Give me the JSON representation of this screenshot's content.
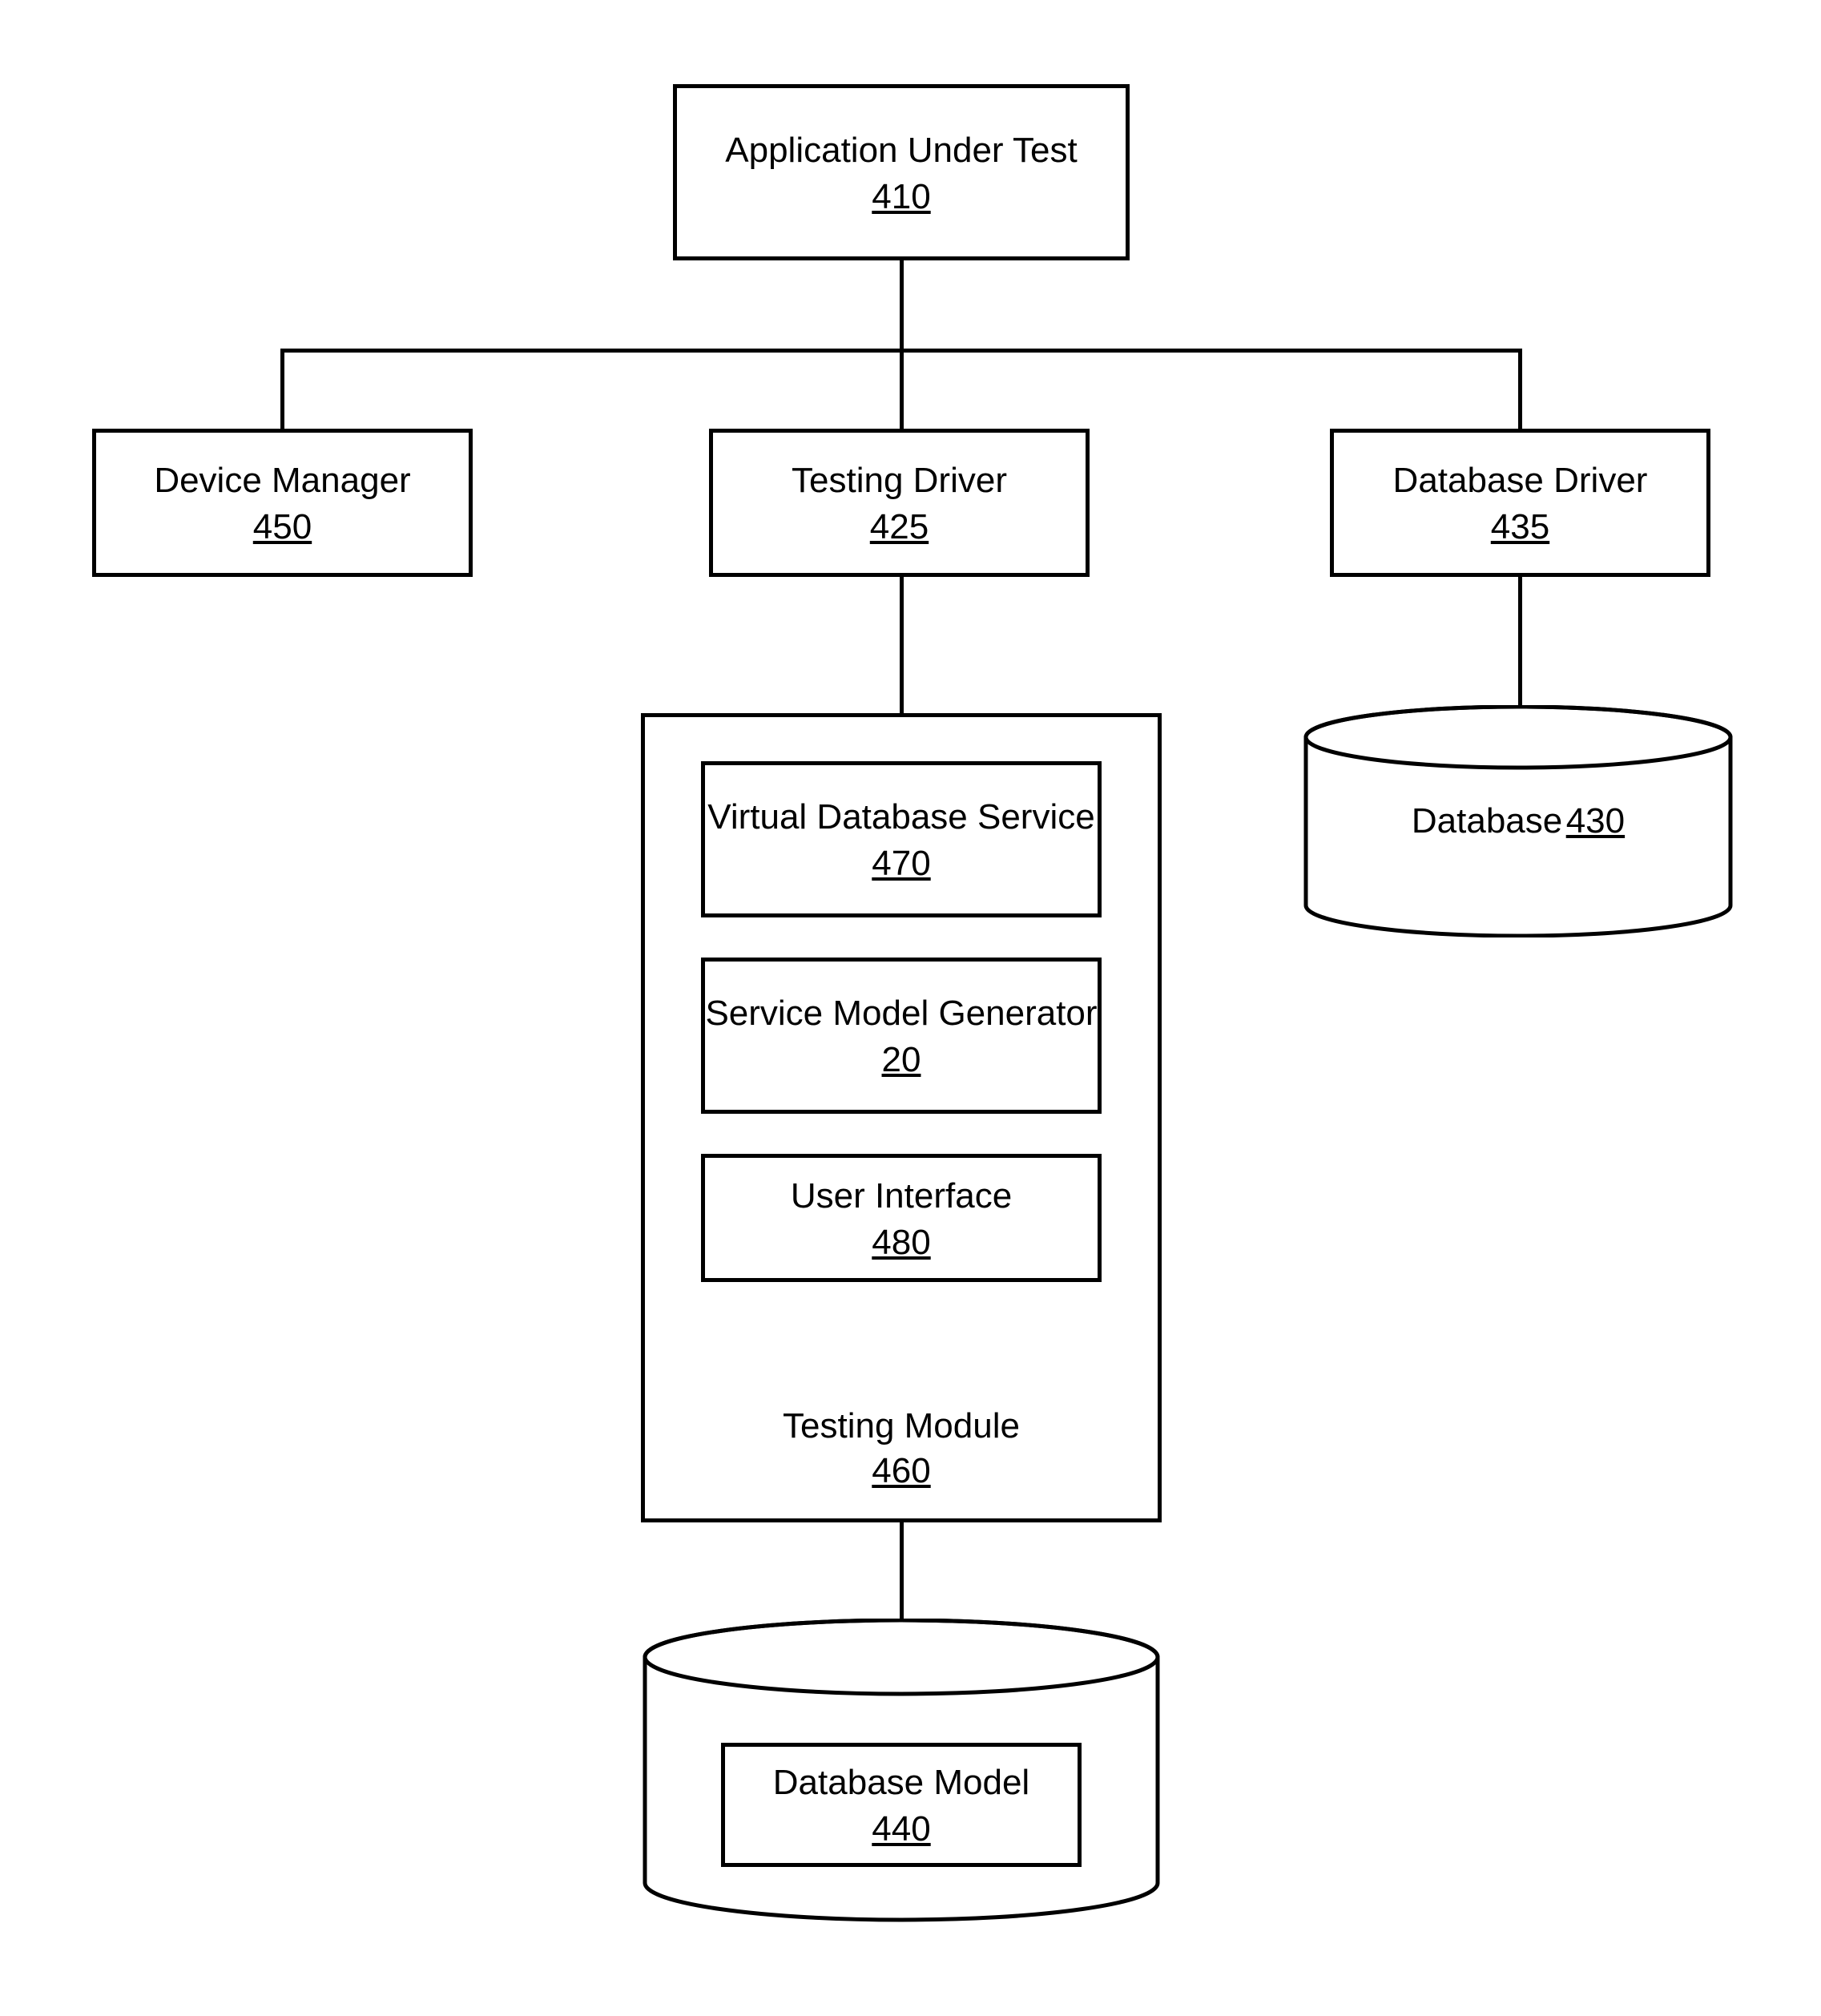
{
  "app_under_test": {
    "label": "Application Under Test",
    "num": "410"
  },
  "device_manager": {
    "label": "Device Manager",
    "num": "450"
  },
  "testing_driver": {
    "label": "Testing Driver",
    "num": "425"
  },
  "database_driver": {
    "label": "Database Driver",
    "num": "435"
  },
  "database": {
    "label": "Database",
    "num": "430"
  },
  "testing_module": {
    "label": "Testing Module",
    "num": "460"
  },
  "virtual_db_service": {
    "label": "Virtual Database Service",
    "num": "470"
  },
  "service_model_gen": {
    "label": "Service Model Generator",
    "num": "20"
  },
  "user_interface": {
    "label": "User Interface",
    "num": "480"
  },
  "database_model": {
    "label": "Database Model",
    "num": "440"
  }
}
